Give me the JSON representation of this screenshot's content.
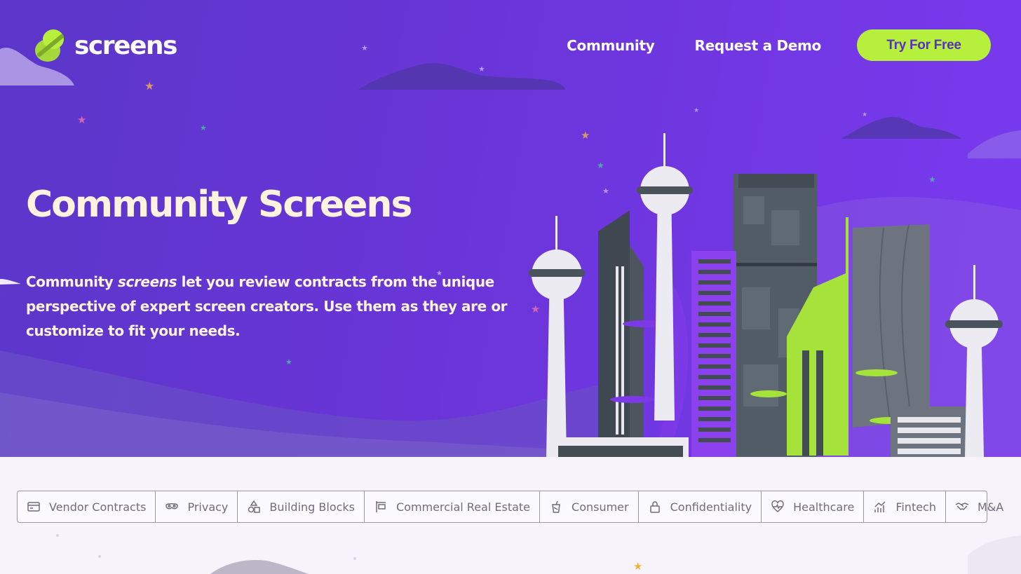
{
  "brand": {
    "name": "screens"
  },
  "nav": {
    "community": "Community",
    "demo": "Request a Demo",
    "cta": "Try For Free"
  },
  "hero": {
    "title": "Community Screens",
    "desc_part1": "Community ",
    "desc_em": "screens",
    "desc_part2": " let you review contracts from the unique perspective of expert screen creators. Use them as they are or customize to fit your needs."
  },
  "categories": [
    {
      "label": "Vendor Contracts",
      "icon": "card-icon"
    },
    {
      "label": "Privacy",
      "icon": "mask-icon"
    },
    {
      "label": "Building Blocks",
      "icon": "shapes-icon"
    },
    {
      "label": "Commercial Real Estate",
      "icon": "sign-icon"
    },
    {
      "label": "Consumer",
      "icon": "cup-icon"
    },
    {
      "label": "Confidentiality",
      "icon": "lock-icon"
    },
    {
      "label": "Healthcare",
      "icon": "heart-pulse-icon"
    },
    {
      "label": "Fintech",
      "icon": "chart-icon"
    },
    {
      "label": "M&A",
      "icon": "handshake-icon"
    }
  ],
  "colors": {
    "hero_start": "#5b36c9",
    "hero_end": "#7a3af0",
    "accent": "#b6f03c",
    "title_text": "#fdf3df",
    "tab_text": "#716b7d"
  }
}
